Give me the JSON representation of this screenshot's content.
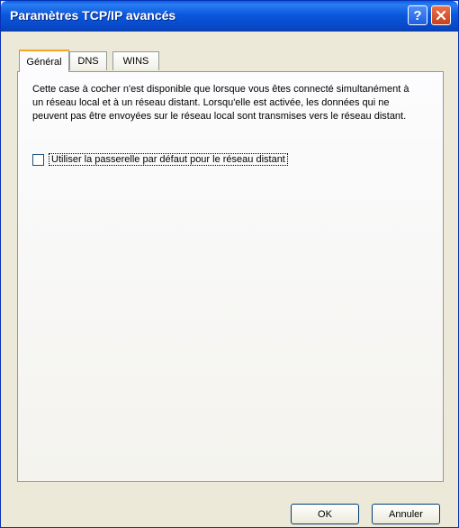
{
  "window": {
    "title": "Paramètres TCP/IP avancés",
    "help_glyph": "?",
    "title_color": "#0a58dc"
  },
  "tabs": [
    {
      "label": "Général",
      "active": true
    },
    {
      "label": "DNS",
      "active": false
    },
    {
      "label": "WINS",
      "active": false
    }
  ],
  "general": {
    "description": "Cette case à cocher n'est disponible que lorsque vous êtes connecté simultanément à un réseau local et à un réseau distant. Lorsqu'elle est activée, les données qui ne peuvent pas être envoyées sur le réseau local sont transmises vers le réseau distant.",
    "checkbox_label": "Utiliser la passerelle par défaut pour le réseau distant",
    "checkbox_checked": false
  },
  "buttons": {
    "ok": "OK",
    "cancel": "Annuler"
  }
}
